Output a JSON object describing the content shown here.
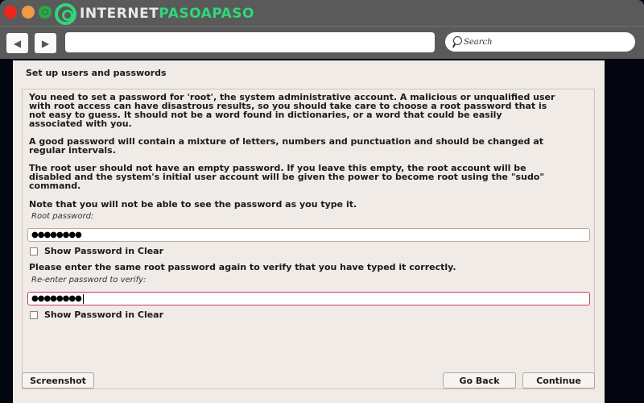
{
  "browser": {
    "brand": {
      "part1": "INTERNET",
      "part2": "PASOAPASO"
    },
    "nav": {
      "back_glyph": "◀",
      "forward_glyph": "▶"
    },
    "url_value": "",
    "search_placeholder": "Search",
    "colors": {
      "chrome": "#5a5a5a",
      "brand_green": "#2fd77a",
      "close": "#f0261c",
      "minimize": "#f39a45",
      "maximize": "#2fa64a"
    }
  },
  "installer": {
    "title": "Set up users and passwords",
    "paragraphs": [
      "You need to set a password for 'root', the system administrative account. A malicious or unqualified user\nwith root access can have disastrous results, so you should take care to choose a root password that is\nnot easy to guess. It should not be a word found in dictionaries, or a word that could be easily\nassociated with you.",
      "A good password will contain a mixture of letters, numbers and punctuation and should be changed at\nregular intervals.",
      "The root user should not have an empty password. If you leave this empty, the root account will be\ndisabled and the system's initial user account will be given the power to become root using the \"sudo\"\ncommand.",
      "Note that you will not be able to see the password as you type it."
    ],
    "root_password": {
      "label": "Root password:",
      "value": "●●●●●●●●",
      "show_clear_label": "Show Password in Clear",
      "show_clear_checked": false
    },
    "verify_prompt": "Please enter the same root password again to verify that you have typed it correctly.",
    "verify_password": {
      "label": "Re-enter password to verify:",
      "value": "●●●●●●●●",
      "show_clear_label": "Show Password in Clear",
      "show_clear_checked": false
    },
    "buttons": {
      "screenshot": "Screenshot",
      "go_back": "Go Back",
      "continue": "Continue"
    },
    "colors": {
      "background": "#f0ebe6",
      "focus_border": "#c2416d"
    }
  }
}
